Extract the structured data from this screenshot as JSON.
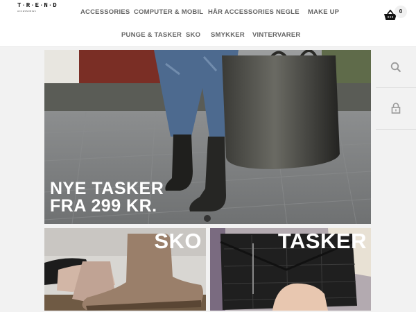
{
  "logo": {
    "text": "T·R·E·N·D",
    "subtext": "ACCESSORIES"
  },
  "nav": {
    "row1": [
      "ACCESSORIES",
      "COMPUTER & MOBIL",
      "HÅR ACCESSORIES",
      "NEGLE",
      "MAKE UP"
    ],
    "row2": [
      "PUNGE & TASKER",
      "SKO",
      "SMYKKER",
      "VINTERVARER"
    ]
  },
  "cart": {
    "count": "0",
    "icon": "basket-icon"
  },
  "sidebar": {
    "icons": [
      "search-icon",
      "lock-icon"
    ]
  },
  "hero": {
    "line1": "NYE TASKER",
    "line2": "FRA 299 KR.",
    "slide_count": 1
  },
  "tiles": [
    {
      "title": "SKO"
    },
    {
      "title": "TASKER"
    }
  ],
  "colors": {
    "nav_text": "#666666",
    "background": "#f2f2f2",
    "header_bg": "#ffffff"
  }
}
